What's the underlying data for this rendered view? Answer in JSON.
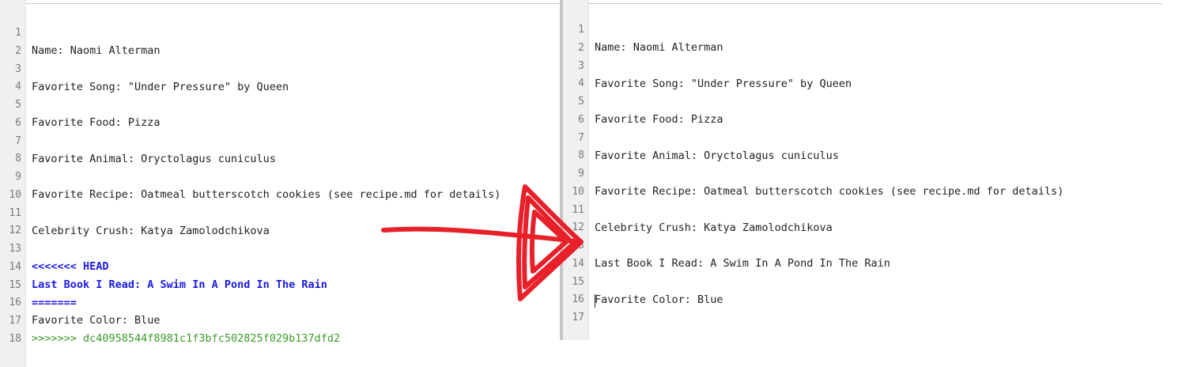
{
  "left_editor": {
    "line_numbers": [
      "1",
      "2",
      "3",
      "4",
      "5",
      "6",
      "7",
      "8",
      "9",
      "10",
      "11",
      "12",
      "13",
      "14",
      "15",
      "16",
      "17",
      "18"
    ],
    "lines": {
      "l1": "Name: Naomi Alterman",
      "l3": "Favorite Song: \"Under Pressure\" by Queen",
      "l5": "Favorite Food: Pizza",
      "l7": "Favorite Animal: Oryctolagus cuniculus",
      "l9": "Favorite Recipe: Oatmeal butterscotch cookies (see recipe.md for details)",
      "l11": "Celebrity Crush: Katya Zamolodchikova",
      "l13": "<<<<<<< HEAD",
      "l14": "Last Book I Read: A Swim In A Pond In The Rain",
      "l15": "=======",
      "l16": "Favorite Color: Blue",
      "l17": ">>>>>>> dc40958544f8981c1f3bfc502825f029b137dfd2"
    }
  },
  "right_editor": {
    "line_numbers": [
      "1",
      "2",
      "3",
      "4",
      "5",
      "6",
      "7",
      "8",
      "9",
      "10",
      "11",
      "12",
      "13",
      "14",
      "15",
      "16",
      "17"
    ],
    "lines": {
      "l1": "Name: Naomi Alterman",
      "l3": "Favorite Song: \"Under Pressure\" by Queen",
      "l5": "Favorite Food: Pizza",
      "l7": "Favorite Animal: Oryctolagus cuniculus",
      "l9": "Favorite Recipe: Oatmeal butterscotch cookies (see recipe.md for details)",
      "l11": "Celebrity Crush: Katya Zamolodchikova",
      "l13": "Last Book I Read: A Swim In A Pond In The Rain",
      "l15": "Favorite Color: Blue"
    }
  },
  "colors": {
    "conflict_marker_head": "#1a1ae6",
    "conflict_marker_incoming": "#3c9a2a",
    "annotation_arrow": "#e8202a"
  },
  "icons": {
    "annotation": "hand-drawn-arrow-icon"
  }
}
